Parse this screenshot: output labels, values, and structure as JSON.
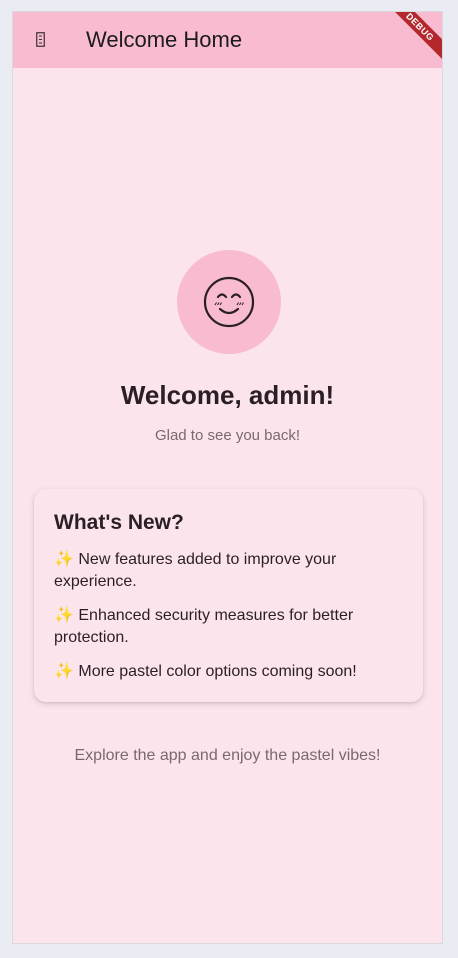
{
  "app_bar": {
    "title": "Welcome Home",
    "leading_icon": "broken-glyph-icon",
    "background": "#f8bbd0"
  },
  "debug_banner": {
    "label": "DEBUG",
    "color": "#b3282d"
  },
  "avatar": {
    "icon": "smiling-face-icon",
    "background": "#f8bbd0"
  },
  "welcome": {
    "title": "Welcome, admin!",
    "subtitle": "Glad to see you back!"
  },
  "whats_new": {
    "title": "What's New?",
    "items": [
      "✨ New features added to improve your experience.",
      "✨ Enhanced security measures for better protection.",
      "✨ More pastel color options coming soon!"
    ]
  },
  "footer": {
    "text": "Explore the app and enjoy the pastel vibes!"
  },
  "colors": {
    "page_background": "#fce4ec",
    "accent": "#f8bbd0"
  }
}
